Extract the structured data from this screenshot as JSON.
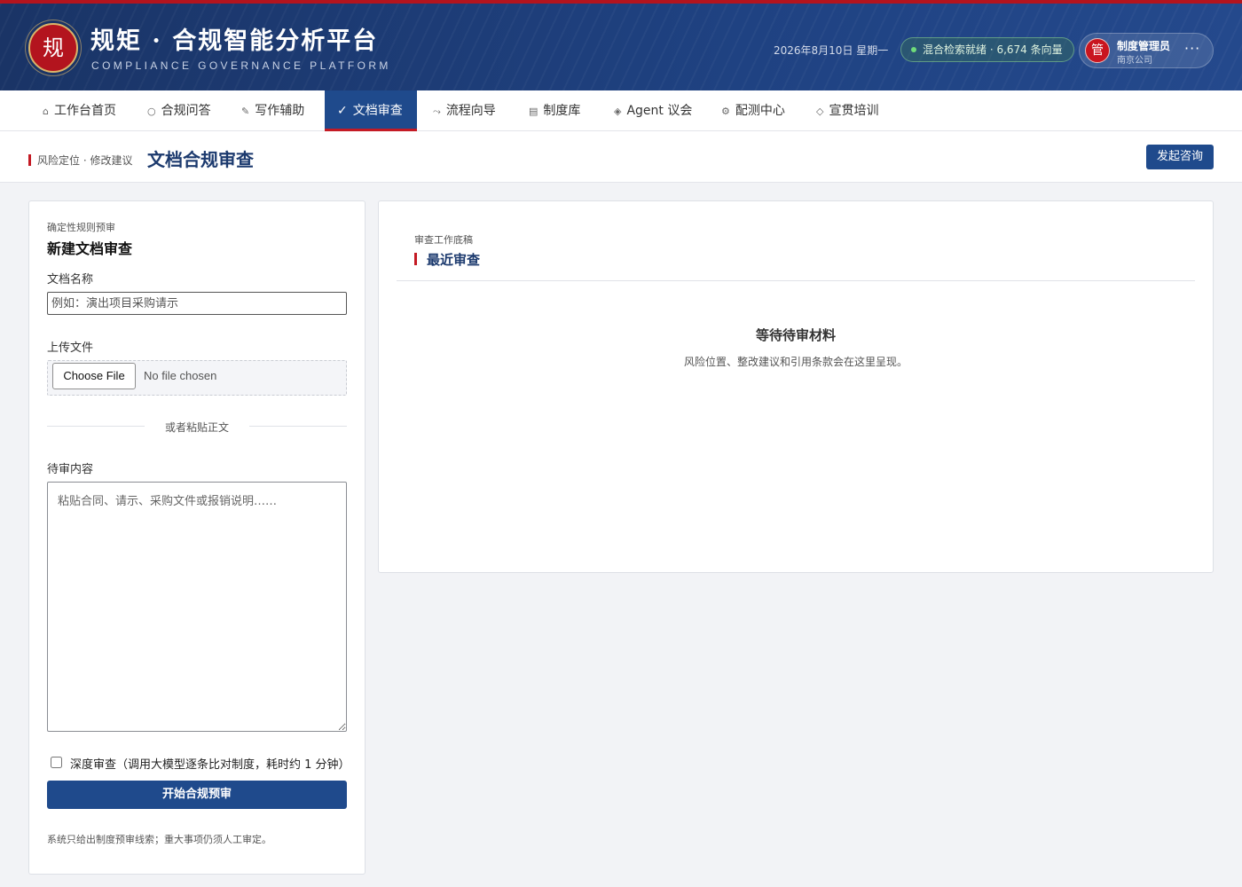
{
  "header": {
    "logo_char": "规",
    "title": "规矩 · 合规智能分析平台",
    "subtitle": "COMPLIANCE GOVERNANCE PLATFORM",
    "date": "2026年8月10日 星期一",
    "status": "混合检索就绪 · 6,674 条向量",
    "user": {
      "avatar_char": "管",
      "name": "制度管理员",
      "org": "南京公司",
      "more": "···"
    }
  },
  "nav": {
    "items": [
      {
        "icon": "⌂",
        "label": "工作台首页"
      },
      {
        "icon": "○",
        "label": "合规问答"
      },
      {
        "icon": "✎",
        "label": "写作辅助"
      },
      {
        "icon": "✓",
        "label": "文档审查",
        "active": true
      },
      {
        "icon": "⤳",
        "label": "流程向导"
      },
      {
        "icon": "▤",
        "label": "制度库"
      },
      {
        "icon": "◈",
        "label": "Agent 议会"
      },
      {
        "icon": "⚙",
        "label": "配测中心"
      },
      {
        "icon": "◇",
        "label": "宣贯培训"
      }
    ]
  },
  "page": {
    "breadcrumb": "风险定位 · 修改建议",
    "title": "文档合规审查",
    "consult_button": "发起咨询"
  },
  "form": {
    "eyebrow": "确定性规则预审",
    "title": "新建文档审查",
    "doc_name_label": "文档名称",
    "doc_name_placeholder": "例如：演出项目采购请示",
    "upload_label": "上传文件",
    "file_button": "Choose File",
    "file_status": "No file chosen",
    "divider": "或者粘贴正文",
    "content_label": "待审内容",
    "content_placeholder": "粘贴合同、请示、采购文件或报销说明……",
    "deep_review_label": "深度审查（调用大模型逐条比对制度，耗时约 1 分钟）",
    "deep_review_checked": false,
    "submit_button": "开始合规预审",
    "note": "系统只给出制度预审线索；重大事项仍须人工审定。"
  },
  "recent": {
    "eyebrow": "审查工作底稿",
    "title": "最近审查",
    "empty_title": "等待待审材料",
    "empty_desc": "风险位置、整改建议和引用条款会在这里呈现。"
  },
  "colors": {
    "navy": "#1f4a8c",
    "header_bg": "#1a3466",
    "accent_red": "#c41a24",
    "status_green": "#6fdc7a"
  }
}
